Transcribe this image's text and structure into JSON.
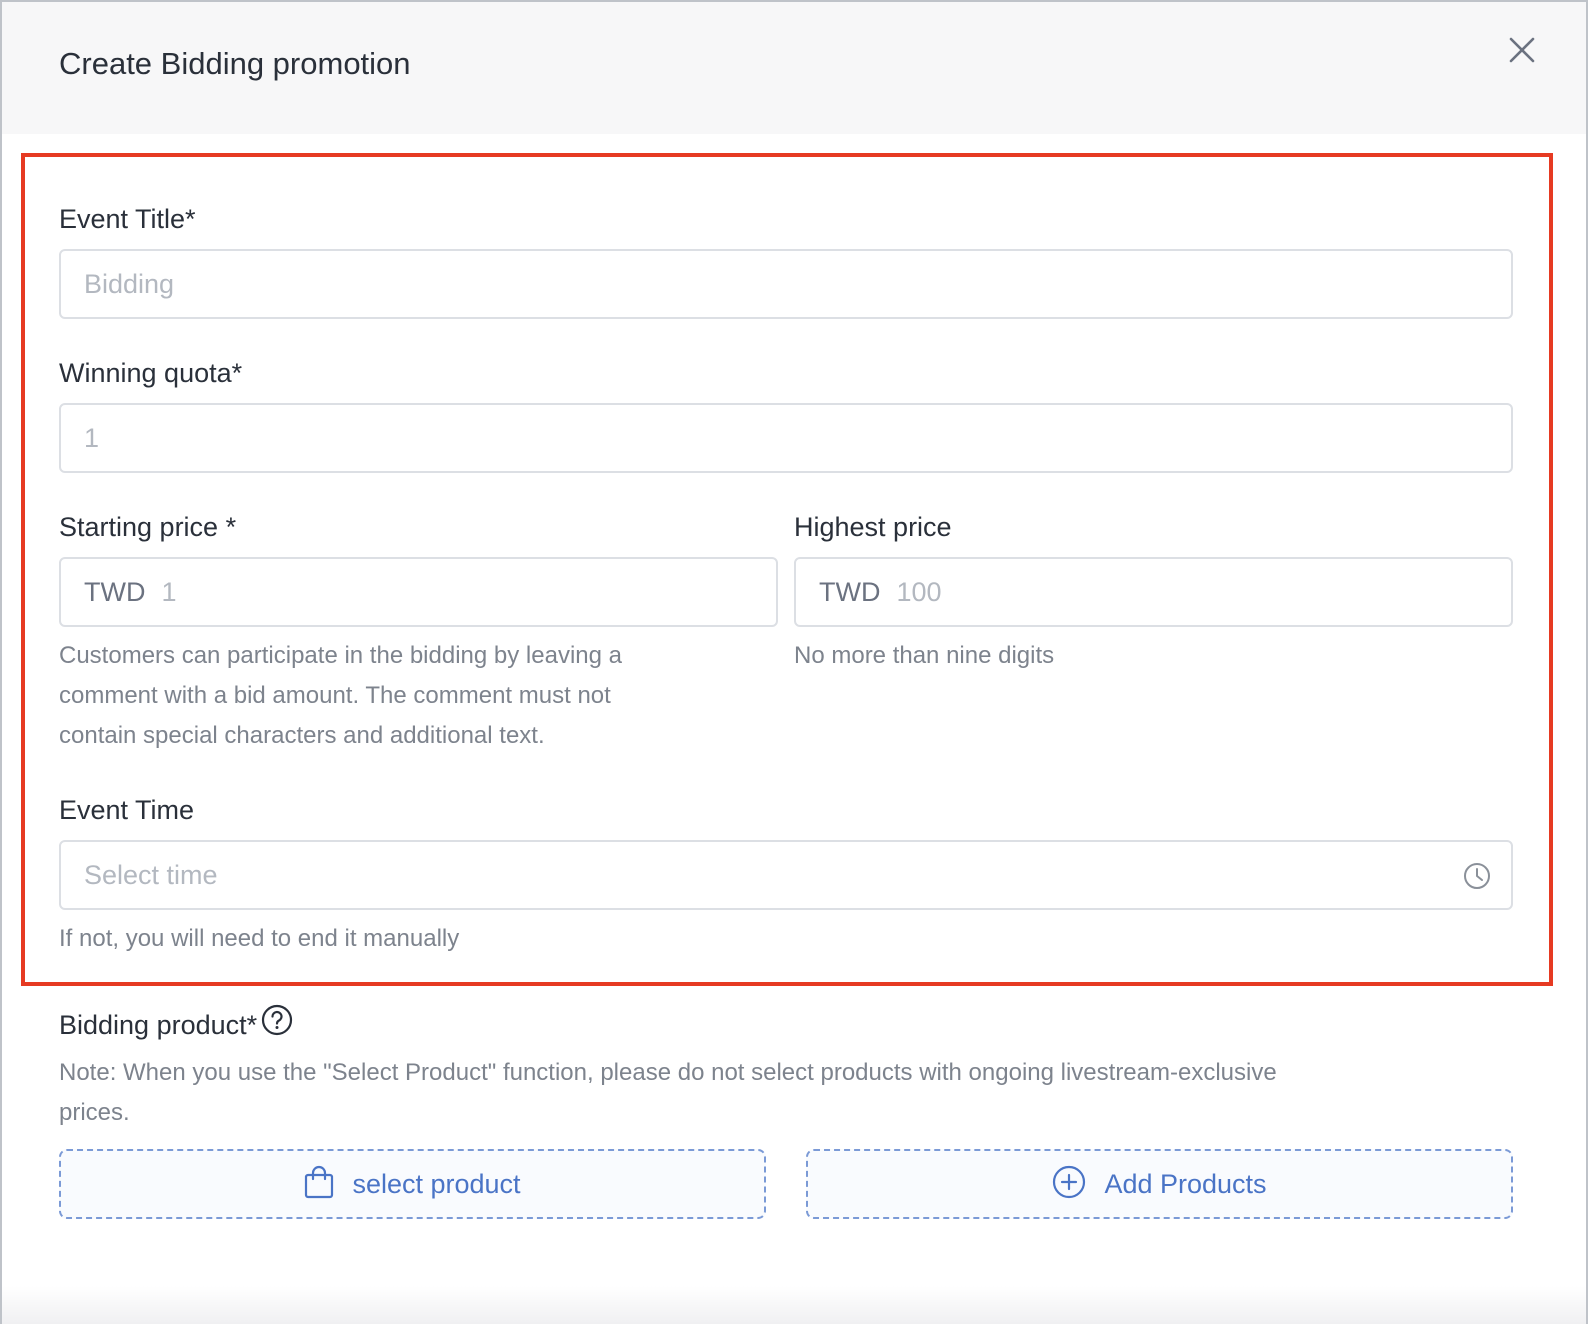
{
  "dialog": {
    "title": "Create Bidding promotion",
    "close_icon": "close-icon"
  },
  "form": {
    "event_title": {
      "label": "Event Title*",
      "placeholder": "Bidding"
    },
    "winning_quota": {
      "label": "Winning quota*",
      "placeholder": "1"
    },
    "starting_price": {
      "label": "Starting price *",
      "currency": "TWD",
      "placeholder": "1",
      "help_lines": [
        "Customers can participate in the bidding by leaving a",
        "comment with a bid amount. The comment must not",
        "contain special characters and additional text."
      ]
    },
    "highest_price": {
      "label": "Highest price",
      "currency": "TWD",
      "placeholder": "100",
      "help": "No more than nine digits"
    },
    "event_time": {
      "label": "Event Time",
      "placeholder": "Select time",
      "help": "If not, you will need to end it manually",
      "icon": "clock-icon"
    },
    "bidding_product": {
      "label": "Bidding product*",
      "help_icon": "question-circle-icon",
      "note_lines": [
        "Note: When you use the \"Select Product\" function, please do not select products with ongoing livestream-exclusive",
        "prices."
      ],
      "select_button": {
        "label": "select product",
        "icon": "shopping-bag-icon"
      },
      "add_button": {
        "label": "Add Products",
        "icon": "plus-circle-icon"
      }
    }
  },
  "colors": {
    "highlight_border": "#e63a22",
    "accent": "#4a74c6",
    "header_bg": "#f7f7f8"
  }
}
